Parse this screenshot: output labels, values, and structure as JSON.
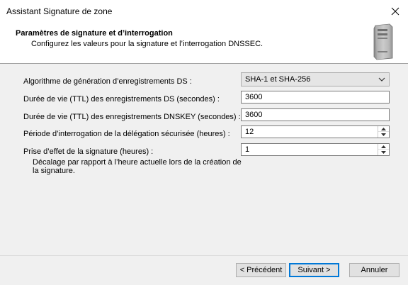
{
  "window": {
    "title": "Assistant Signature de zone"
  },
  "header": {
    "title": "Paramètres de signature et d’interrogation",
    "subtitle": "Configurez les valeurs pour la signature et l’interrogation DNSSEC."
  },
  "form": {
    "ds_algorithm": {
      "label": "Algorithme de génération d’enregistrements DS :",
      "value": "SHA-1 et SHA-256"
    },
    "ds_ttl": {
      "label": "Durée de vie (TTL) des enregistrements DS (secondes) :",
      "value": "3600"
    },
    "dnskey_ttl": {
      "label": "Durée de vie (TTL) des enregistrements DNSKEY (secondes) :",
      "value": "3600"
    },
    "polling": {
      "label": "Période d’interrogation de la délégation sécurisée (heures) :",
      "value": "12"
    },
    "effect": {
      "label": "Prise d’effet de la signature (heures) :",
      "value": "1",
      "description": "Décalage par rapport à l’heure actuelle lors de la création de la signature."
    }
  },
  "buttons": {
    "previous": "< Précédent",
    "next": "Suivant >",
    "cancel": "Annuler"
  },
  "colors": {
    "accent": "#0078d7",
    "window_bg": "#f0f0f0",
    "header_bg": "#ffffff"
  }
}
